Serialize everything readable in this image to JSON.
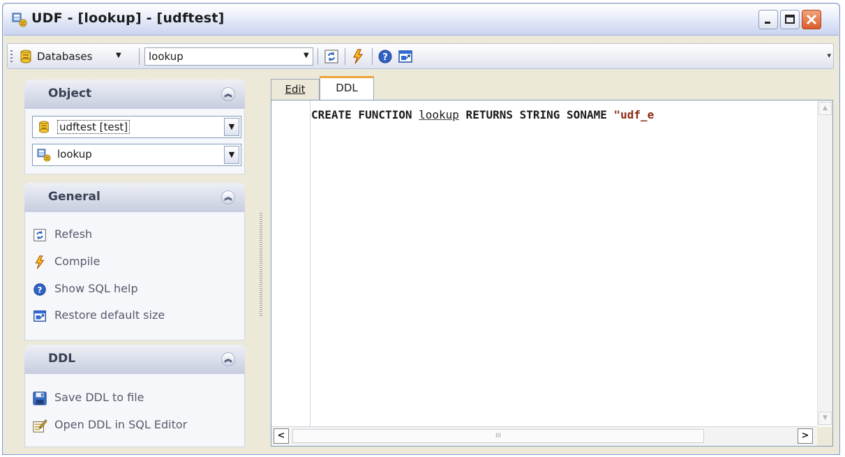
{
  "window": {
    "title": "UDF - [lookup] - [udftest]"
  },
  "toolbar": {
    "databases_label": "Databases",
    "object_combo_value": "lookup",
    "buttons": [
      "refresh-icon",
      "compile-icon",
      "help-icon",
      "restore-size-icon"
    ]
  },
  "panels": {
    "object": {
      "header": "Object",
      "database_value": "udftest [test]",
      "object_value": "lookup"
    },
    "general": {
      "header": "General",
      "items": [
        {
          "label": "Refesh",
          "icon": "refresh-icon"
        },
        {
          "label": "Compile",
          "icon": "compile-icon"
        },
        {
          "label": "Show SQL help",
          "icon": "help-icon"
        },
        {
          "label": "Restore default size",
          "icon": "restore-size-icon"
        }
      ]
    },
    "ddl": {
      "header": "DDL",
      "items": [
        {
          "label": "Save DDL to file",
          "icon": "save-icon"
        },
        {
          "label": "Open DDL in SQL Editor",
          "icon": "open-in-editor-icon"
        }
      ]
    }
  },
  "tabs": [
    {
      "label": "Edit",
      "active": false
    },
    {
      "label": "DDL",
      "active": true
    }
  ],
  "editor": {
    "code_kw1": "CREATE FUNCTION ",
    "code_ident": "lookup",
    "code_kw2": " RETURNS STRING SONAME ",
    "code_str": "\"udf_e",
    "hscroll_grip": "III"
  },
  "colors": {
    "accent_tab": "#f0a23a",
    "panel_header": "#c7cde0",
    "window_border": "#7a96df"
  }
}
